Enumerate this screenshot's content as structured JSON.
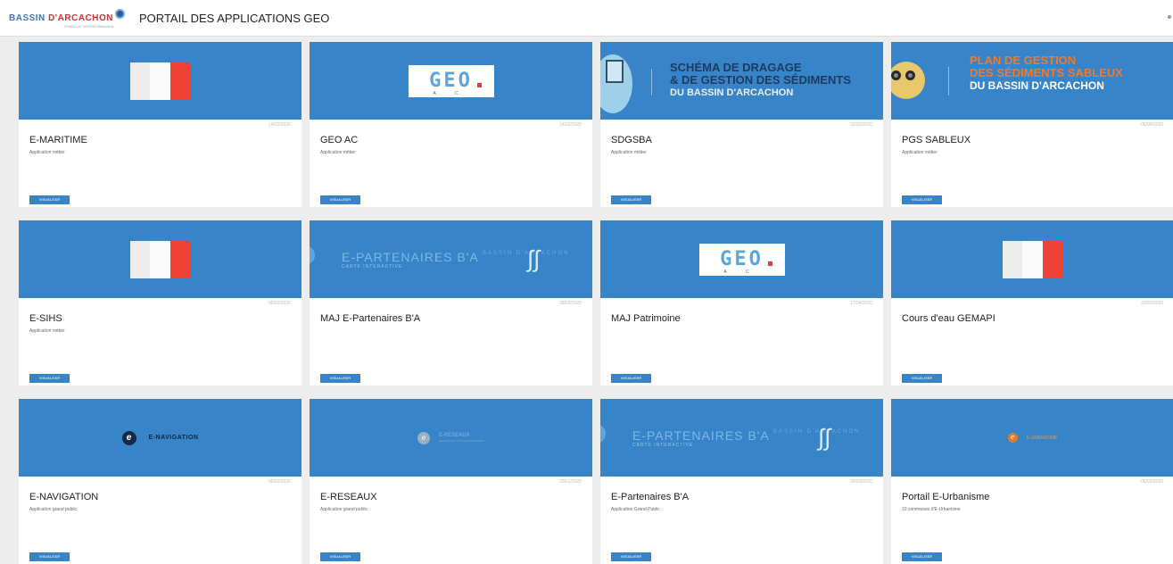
{
  "header": {
    "logo_part1": "BASSIN",
    "logo_part2": "D'ARCACHON",
    "logo_sub": "SYNDICAT INTERCOMMUNAL",
    "title": "PORTAIL DES APPLICATIONS GEO"
  },
  "banners": {
    "geo_letters": "GEO",
    "geo_a": "A",
    "geo_c": "C",
    "sdgsba_line1": "SCHÉMA DE DRAGAGE",
    "sdgsba_line2": "& DE GESTION DES SÉDIMENTS",
    "sdgsba_line3": "DU BASSIN D'ARCACHON",
    "pgs_line1": "PLAN DE GESTION",
    "pgs_line2": "DES SÉDIMENTS SABLEUX",
    "pgs_line3": "DU BASSIN D'ARCACHON",
    "partenaires_title": "E-PARTENAIRES B'A",
    "partenaires_sub": "CARTE INTERACTIVE",
    "partenaires_mark": "BASSIN D'ARCACHON",
    "nav_logo": "E-NAVIGATION",
    "reseaux_logo": "E-RESEAUX",
    "reseaux_sub": "RESEAUX ET CONCESSIONNAIRES",
    "urbanisme_logo": "E-URBANISME"
  },
  "cards": [
    {
      "title": "E-MARITIME",
      "subtitle": "Application métier",
      "date": "14/02/2020",
      "button": "VISUALISER"
    },
    {
      "title": "GEO AC",
      "subtitle": "Application métier",
      "date": "14/02/2020",
      "button": "VISUALISER"
    },
    {
      "title": "SDGSBA",
      "subtitle": "Application métier",
      "date": "03/02/2020",
      "button": "VISUALISER"
    },
    {
      "title": "PGS SABLEUX",
      "subtitle": "Application métier",
      "date": "08/06/2020",
      "button": "VISUALISER"
    },
    {
      "title": "E-SIHS",
      "subtitle": "Application métier",
      "date": "05/02/2020",
      "button": "VISUALISER"
    },
    {
      "title": "MAJ E-Partenaires B'A",
      "subtitle": "",
      "date": "09/03/2020",
      "button": "VISUALISER"
    },
    {
      "title": "MAJ Patrimoine",
      "subtitle": "",
      "date": "17/04/2020",
      "button": "VISUALISER"
    },
    {
      "title": "Cours d'eau GEMAPI",
      "subtitle": "",
      "date": "26/03/2020",
      "button": "VISUALISER"
    },
    {
      "title": "E-NAVIGATION",
      "subtitle": "Application grand public",
      "date": "05/02/2020",
      "button": "VISUALISER"
    },
    {
      "title": "E-RESEAUX",
      "subtitle": "Application grand public",
      "date": "20/01/2020",
      "button": "VISUALISER"
    },
    {
      "title": "E-Partenaires B'A",
      "subtitle": "Application Grand Public",
      "date": "09/03/2020",
      "button": "VISUALISER"
    },
    {
      "title": "Portail E-Urbanisme",
      "subtitle": "10 communes d'E-Urbanisme",
      "date": "08/02/2020",
      "button": "VISUALISER"
    }
  ]
}
